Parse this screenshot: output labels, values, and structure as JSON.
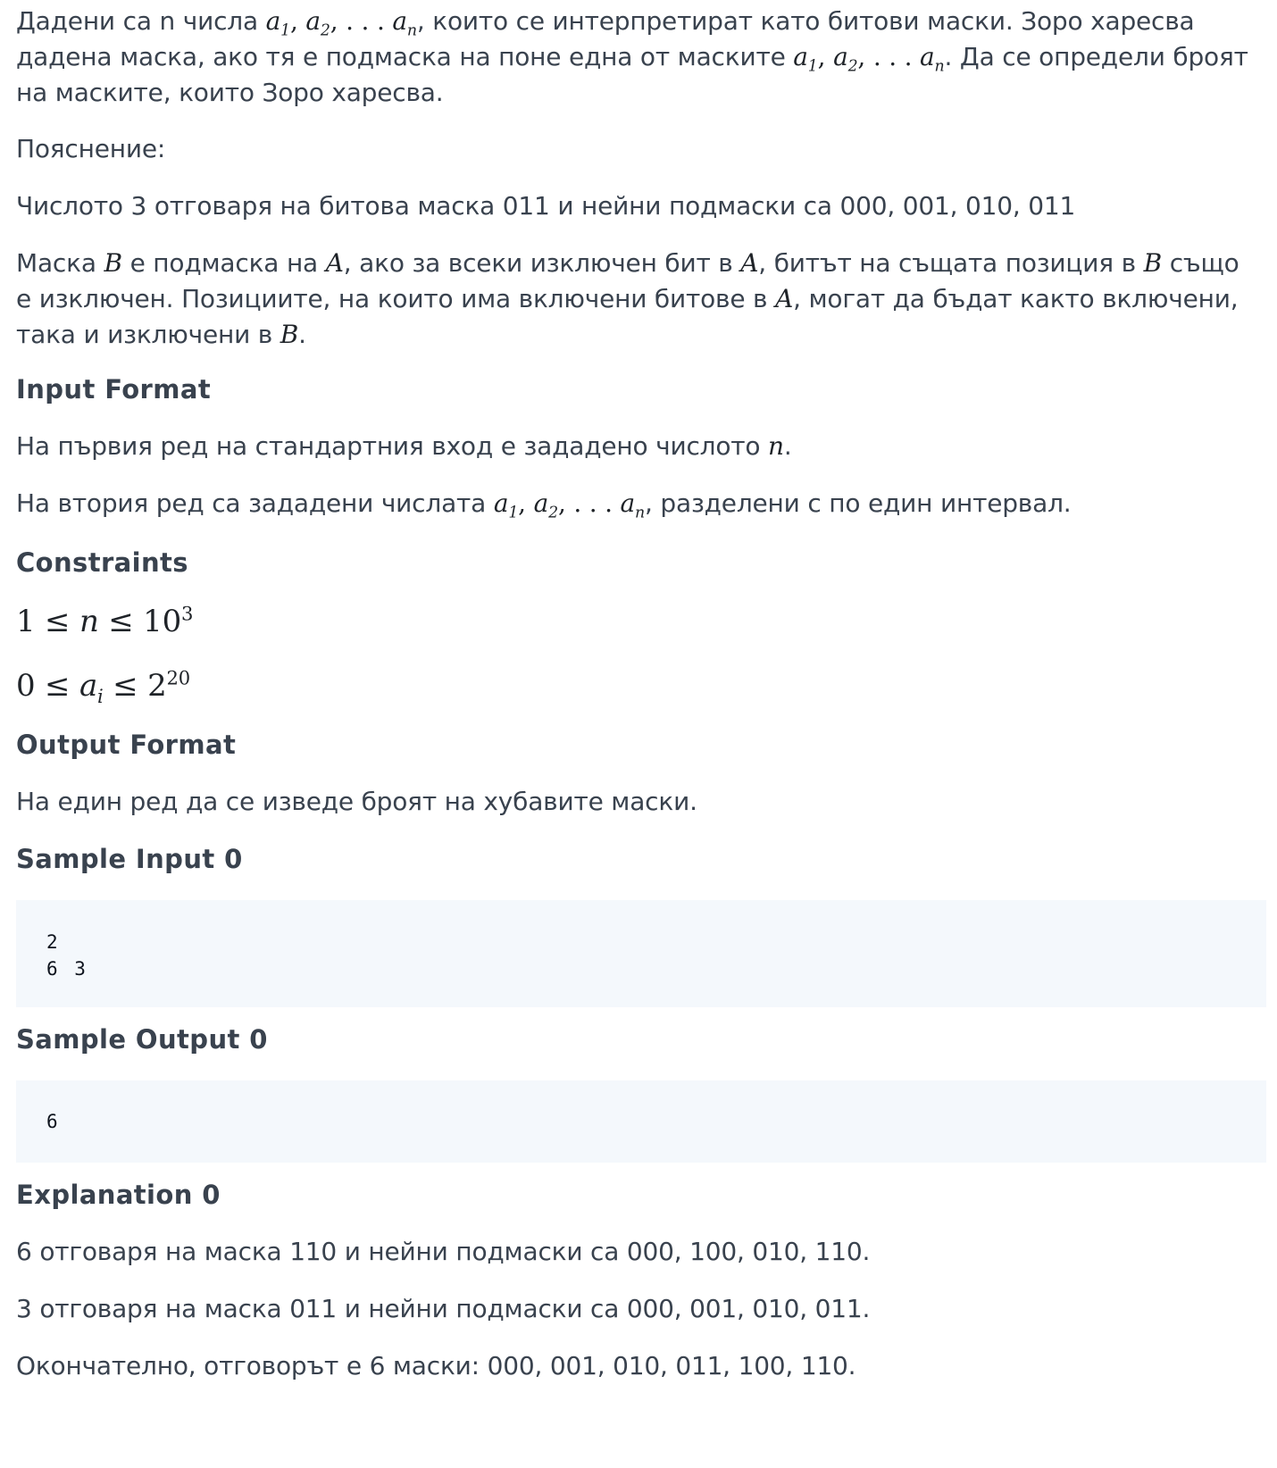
{
  "intro": {
    "t1": "Дадени са n числа ",
    "t2": ", които се интерпретират като битови маски. Зоро харесва дадена маска, ако тя е подмаска на поне една от маските ",
    "t3": ". Да се определи броят на маските, които Зоро харесва."
  },
  "math": {
    "a": "a",
    "one": "1",
    "two": "2",
    "n": "n",
    "sep": ", ",
    "dots": ", . . . ",
    "A": "A",
    "B": "B",
    "i": "i"
  },
  "explanation_label": "Пояснение:",
  "example_line": "Числото 3 отговаря на битова маска 011 и нейни подмаски са 000, 001, 010, 011",
  "definition": {
    "t1": "Маска ",
    "t2": " е подмаска на ",
    "t3": ", ако за всеки изключен бит в ",
    "t4": ", битът на същата позиция в ",
    "t5": " също е изключен. Позициите, на които има включени битове в ",
    "t6": ", могат да бъдат както включени, така и изключени в ",
    "t7": "."
  },
  "input_format": {
    "heading": "Input Format",
    "line1_a": "На първия ред на стандартния вход е зададено числото ",
    "line1_b": ".",
    "line2_a": "На втория ред са зададени числата ",
    "line2_b": ", разделени с по един интервал."
  },
  "constraints": {
    "heading": "Constraints",
    "c1_left": "1 ≤ ",
    "c1_mid": " ≤ 10",
    "c1_exp": "3",
    "c2_left": "0 ≤ ",
    "c2_mid": " ≤ 2",
    "c2_exp": "20"
  },
  "output_format": {
    "heading": "Output Format",
    "line": "На един ред да се изведе броят на хубавите маски."
  },
  "sample_input": {
    "heading": "Sample Input 0",
    "lines": [
      "2",
      "6 3"
    ]
  },
  "sample_output": {
    "heading": "Sample Output 0",
    "lines": [
      "6"
    ]
  },
  "explanation": {
    "heading": "Explanation 0",
    "lines": [
      "6 отговаря на маска 110 и нейни подмаски са 000, 100, 010, 110.",
      "3 отговаря на маска 011 и нейни подмаски са 000, 001, 010, 011.",
      "Окончателно, отговорът е 6 маски: 000, 001, 010, 011, 100, 110."
    ]
  }
}
